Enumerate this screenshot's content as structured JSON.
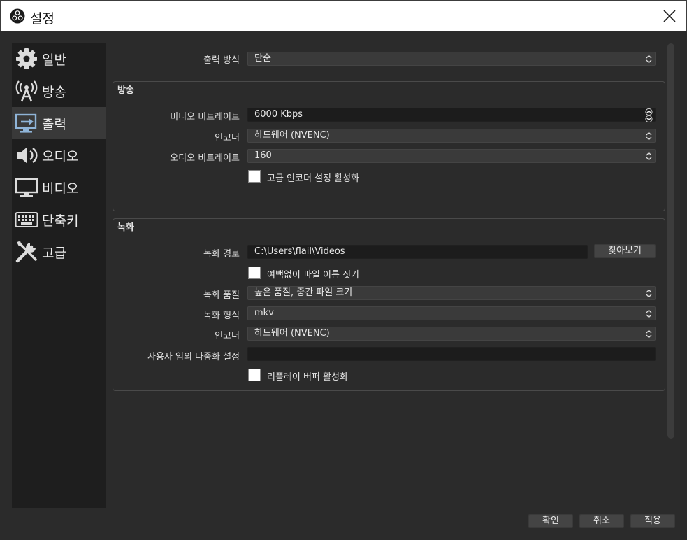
{
  "window": {
    "title": "설정"
  },
  "sidebar": {
    "items": [
      {
        "label": "일반",
        "icon": "gear-icon"
      },
      {
        "label": "방송",
        "icon": "broadcast-antenna-icon"
      },
      {
        "label": "출력",
        "icon": "output-monitor-icon"
      },
      {
        "label": "오디오",
        "icon": "speaker-icon"
      },
      {
        "label": "비디오",
        "icon": "monitor-icon"
      },
      {
        "label": "단축키",
        "icon": "keyboard-icon"
      },
      {
        "label": "고급",
        "icon": "tools-icon"
      }
    ],
    "active_item": "출력"
  },
  "output_mode": {
    "label": "출력 방식",
    "value": "단순"
  },
  "streaming": {
    "title": "방송",
    "video_bitrate": {
      "label": "비디오 비트레이트",
      "value": "6000 Kbps"
    },
    "encoder": {
      "label": "인코더",
      "value": "하드웨어 (NVENC)"
    },
    "audio_bitrate": {
      "label": "오디오 비트레이트",
      "value": "160"
    },
    "advanced_encoder": {
      "label": "고급 인코더 설정 활성화",
      "checked": false
    }
  },
  "recording": {
    "title": "녹화",
    "path": {
      "label": "녹화 경로",
      "value": "C:\\Users\\flail\\Videos",
      "browse_label": "찾아보기"
    },
    "no_space": {
      "label": "여백없이 파일 이름 짓기",
      "checked": false
    },
    "quality": {
      "label": "녹화 품질",
      "value": "높은 품질, 중간 파일 크기"
    },
    "format": {
      "label": "녹화 형식",
      "value": "mkv"
    },
    "encoder": {
      "label": "인코더",
      "value": "하드웨어 (NVENC)"
    },
    "muxer": {
      "label": "사용자 임의 다중화 설정",
      "value": ""
    },
    "replay_buffer": {
      "label": "리플레이 버퍼 활성화",
      "checked": false
    }
  },
  "footer": {
    "ok_label": "확인",
    "cancel_label": "취소",
    "apply_label": "적용"
  }
}
